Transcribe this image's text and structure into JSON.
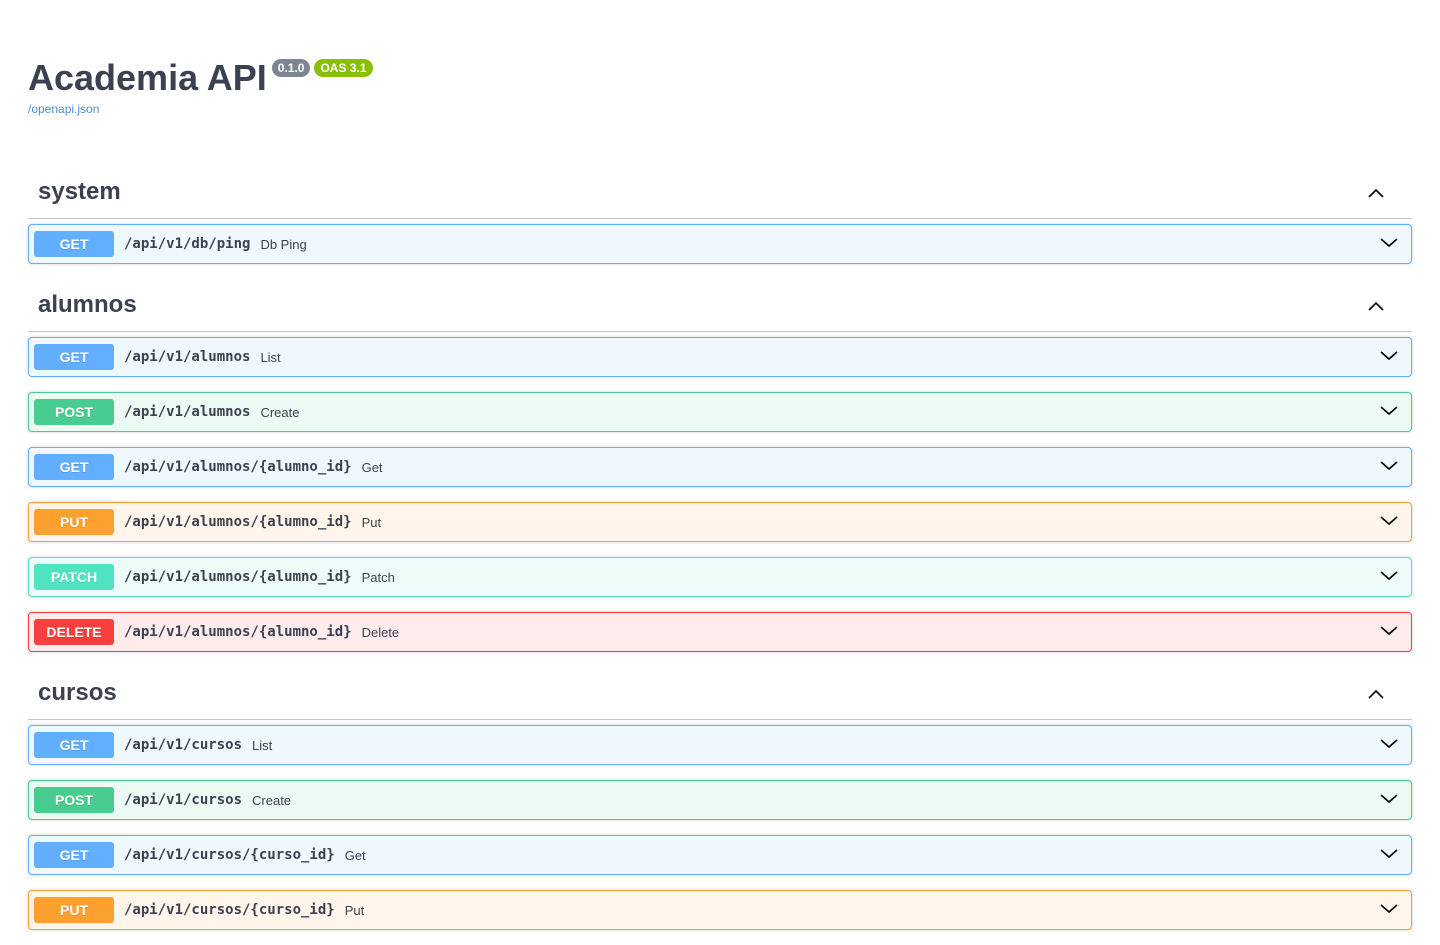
{
  "header": {
    "title": "Academia API",
    "version_badge": "0.1.0",
    "oas_badge": "OAS 3.1",
    "spec_link": "/openapi.json"
  },
  "colors": {
    "get": "#61affe",
    "post": "#49cc90",
    "put": "#fca130",
    "patch": "#50e3c2",
    "delete": "#f93e3e"
  },
  "tags": [
    {
      "name": "system",
      "operations": [
        {
          "method": "GET",
          "path": "/api/v1/db/ping",
          "summary": "Db Ping"
        }
      ]
    },
    {
      "name": "alumnos",
      "operations": [
        {
          "method": "GET",
          "path": "/api/v1/alumnos",
          "summary": "List"
        },
        {
          "method": "POST",
          "path": "/api/v1/alumnos",
          "summary": "Create"
        },
        {
          "method": "GET",
          "path": "/api/v1/alumnos/{alumno_id}",
          "summary": "Get"
        },
        {
          "method": "PUT",
          "path": "/api/v1/alumnos/{alumno_id}",
          "summary": "Put"
        },
        {
          "method": "PATCH",
          "path": "/api/v1/alumnos/{alumno_id}",
          "summary": "Patch"
        },
        {
          "method": "DELETE",
          "path": "/api/v1/alumnos/{alumno_id}",
          "summary": "Delete"
        }
      ]
    },
    {
      "name": "cursos",
      "operations": [
        {
          "method": "GET",
          "path": "/api/v1/cursos",
          "summary": "List"
        },
        {
          "method": "POST",
          "path": "/api/v1/cursos",
          "summary": "Create"
        },
        {
          "method": "GET",
          "path": "/api/v1/cursos/{curso_id}",
          "summary": "Get"
        },
        {
          "method": "PUT",
          "path": "/api/v1/cursos/{curso_id}",
          "summary": "Put"
        }
      ]
    }
  ],
  "icons": {
    "tag_toggle": "chevron-up-icon",
    "op_expand": "chevron-down-icon"
  }
}
